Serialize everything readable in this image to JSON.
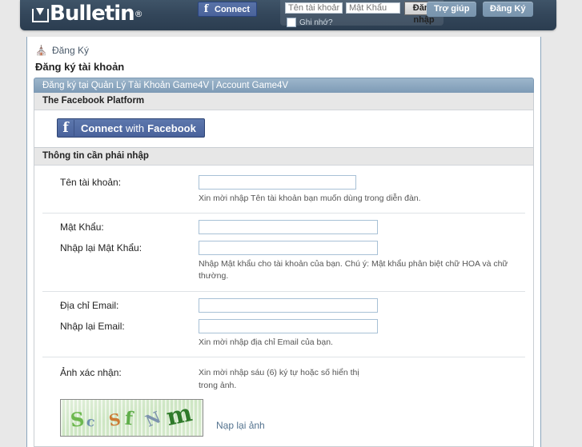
{
  "header": {
    "logo_text": "Bulletin",
    "logo_reg": "®",
    "fb_connect_label": "Connect",
    "login": {
      "username_placeholder": "Tên tài khoản",
      "username_value": "",
      "password_placeholder": "Mật Khẩu",
      "password_value": "",
      "submit_label": "Đăng nhập",
      "remember_label": "Ghi nhớ?",
      "remember_checked": false
    },
    "nav": {
      "help_label": "Trợ giúp",
      "register_label": "Đăng Ký"
    }
  },
  "breadcrumb": {
    "home_icon": "home-icon",
    "current": "Đăng Ký"
  },
  "page": {
    "title": "Đăng ký tài khoản",
    "bar_title": "Đăng ký tại Quản Lý Tài Khoản Game4V | Account Game4V"
  },
  "facebook_section": {
    "heading": "The Facebook Platform",
    "button_primary": "Connect",
    "button_mid": "with",
    "button_suffix": "Facebook"
  },
  "form_section": {
    "heading": "Thông tin cần phải nhập",
    "fields": [
      {
        "label": "Tên tài khoản:",
        "value": "",
        "hint": "Xin mời nhập Tên tài khoản bạn muốn dùng trong diễn đàn."
      },
      {
        "label": "Mật Khẩu:",
        "value": ""
      },
      {
        "label": "Nhập lại Mật Khẩu:",
        "value": "",
        "hint": "Nhập Mật khẩu cho tài khoản của bạn. Chú ý: Mật khẩu phân biệt chữ HOA và chữ thường."
      },
      {
        "label": "Địa chỉ Email:",
        "value": ""
      },
      {
        "label": "Nhập lại Email:",
        "value": "",
        "hint": "Xin mời nhập địa chỉ Email của bạn."
      }
    ],
    "captcha": {
      "label": "Ảnh xác nhận:",
      "hint": "Xin mời nhập sáu (6) ký tự hoặc số hiển thị trong ảnh.",
      "reload_label": "Nạp lại ảnh",
      "characters": [
        "S",
        "c",
        "S",
        "f",
        "N",
        "m"
      ]
    }
  },
  "colors": {
    "header_dark": "#33465a",
    "accent_blue": "#8ba6bd",
    "facebook_blue": "#4a639b",
    "link_blue": "#54738f",
    "page_bg": "#e8e8e8"
  }
}
